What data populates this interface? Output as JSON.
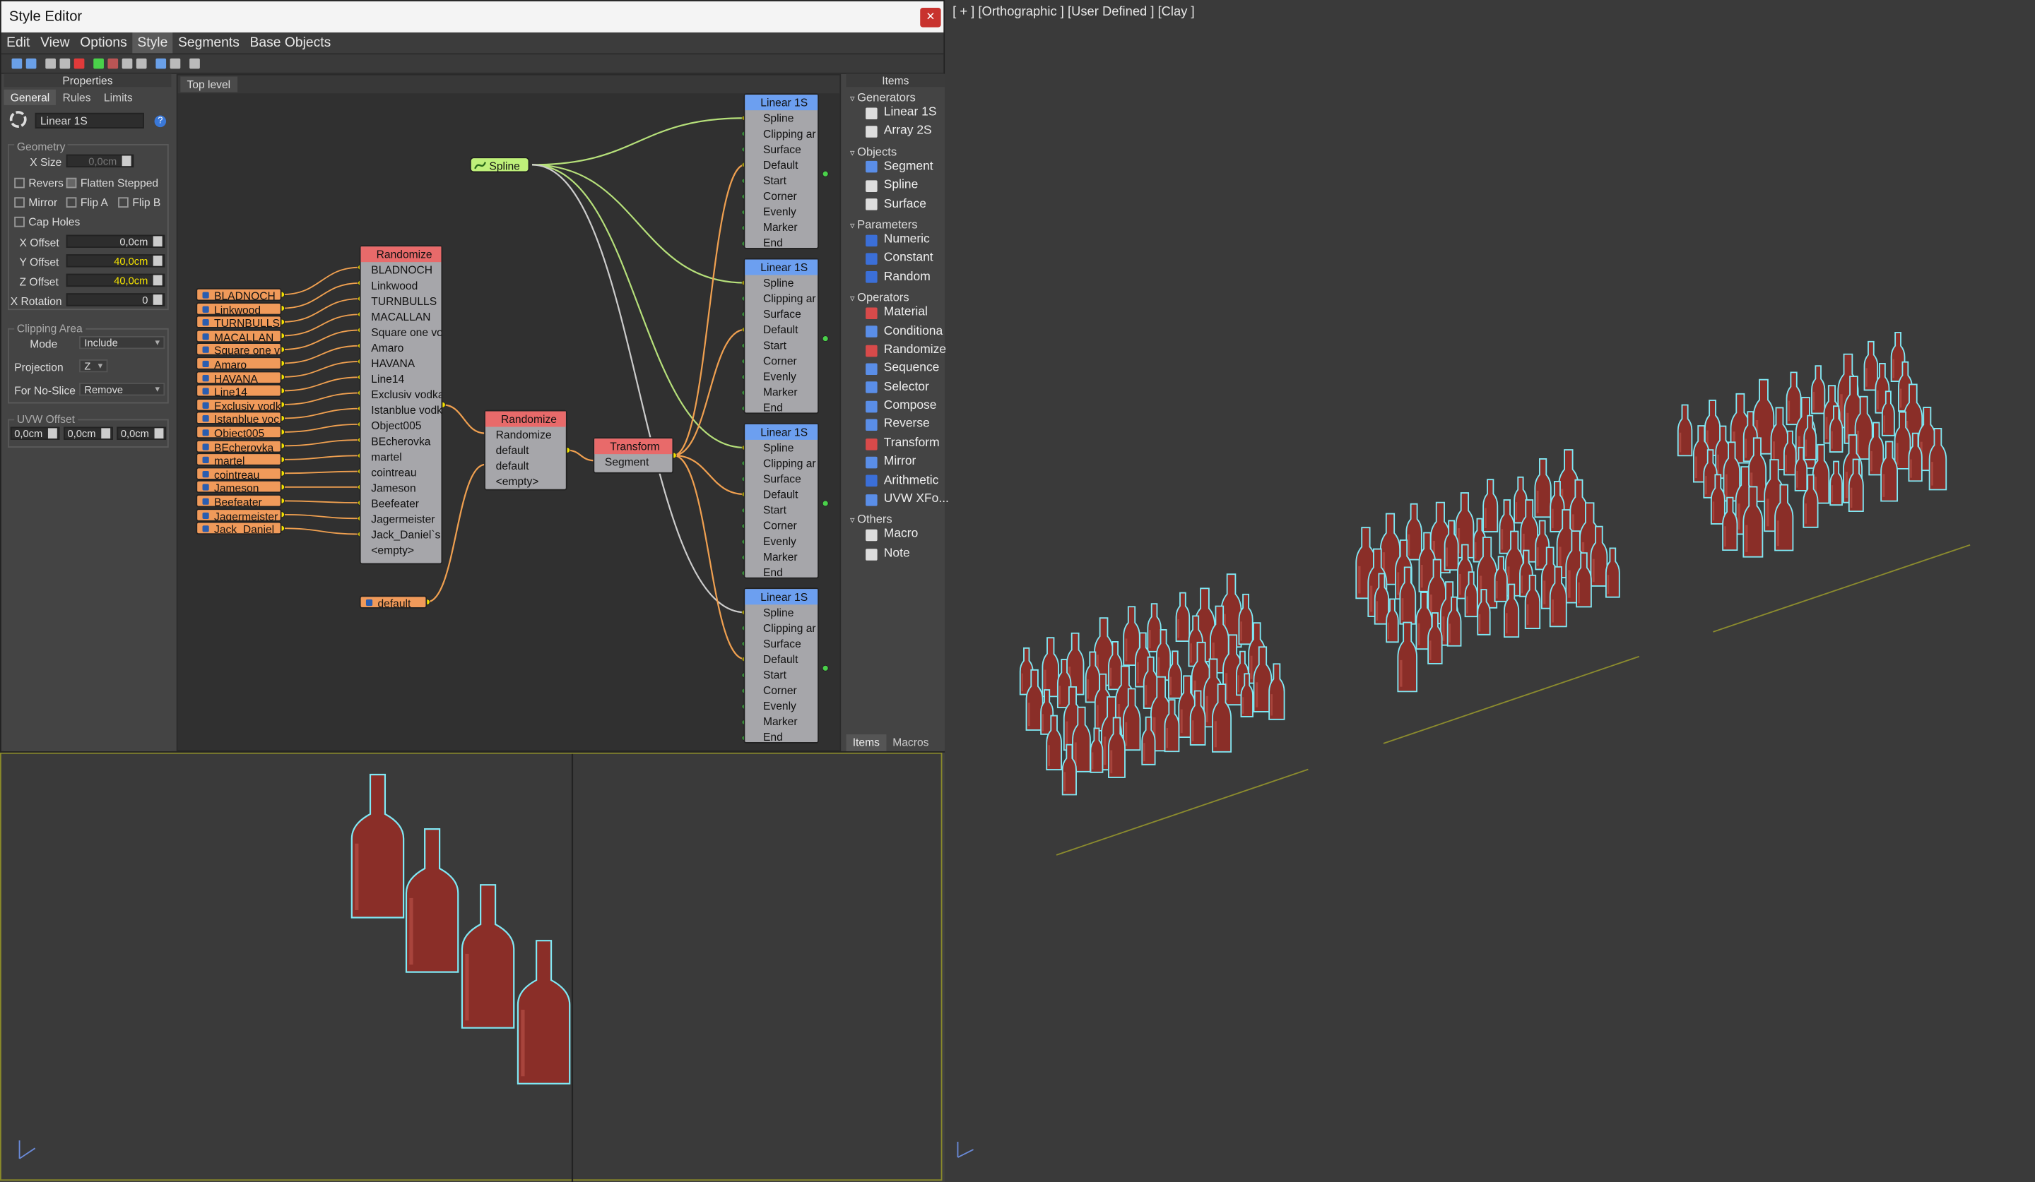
{
  "window": {
    "title": "Style Editor",
    "close_glyph": "×"
  },
  "menu": [
    "Edit",
    "View",
    "Options",
    "Style",
    "Segments",
    "Base Objects"
  ],
  "properties": {
    "header": "Properties",
    "tabs": [
      "General",
      "Rules",
      "Limits"
    ],
    "name": "Linear 1S",
    "help_glyph": "?",
    "geometry_label": "Geometry",
    "x_size_label": "X Size",
    "x_size_value": "0,0cm",
    "reverse_label": "Revers",
    "flatten_label": "Flatten Stepped",
    "mirror_label": "Mirror",
    "flip_a_label": "Flip A",
    "flip_b_label": "Flip B",
    "cap_holes_label": "Cap Holes",
    "x_offset_label": "X Offset",
    "x_offset_value": "0,0cm",
    "y_offset_label": "Y Offset",
    "y_offset_value": "40,0cm",
    "z_offset_label": "Z Offset",
    "z_offset_value": "40,0cm",
    "rotation_label": "X Rotation",
    "rotation_value": "0",
    "clipping_label": "Clipping Area",
    "mode_label": "Mode",
    "mode_value": "Include",
    "projection_label": "Projection",
    "projection_value": "Z",
    "noslice_label": "For No-Slice",
    "noslice_value": "Remove",
    "uvw_label": "UVW Offset",
    "uvw_values": [
      "0,0cm",
      "0,0cm",
      "0,0cm"
    ]
  },
  "graph": {
    "tab": "Top level",
    "spline_label": "Spline",
    "default_label": "default",
    "chips": [
      "BLADNOCH",
      "Linkwood",
      "TURNBULLS",
      "MACALLAN",
      "Square one v",
      "Amaro",
      "HAVANA",
      "Line14",
      "Exclusiv vodk",
      "Istanblue voc",
      "Object005",
      "BEcherovka",
      "martel",
      "cointreau",
      "Jameson",
      "Beefeater",
      "Jagermeister",
      "Jack_Daniel"
    ],
    "randomize1": {
      "title": "Randomize",
      "ports": [
        "BLADNOCH",
        "Linkwood",
        "TURNBULLS",
        "MACALLAN",
        "Square one vo",
        "Amaro",
        "HAVANA",
        "Line14",
        "Exclusiv vodka",
        "Istanblue vodk",
        "Object005",
        "BEcherovka",
        "martel",
        "cointreau",
        "Jameson",
        "Beefeater",
        "Jagermeister",
        "Jack_Daniel`s",
        "<empty>"
      ]
    },
    "randomize2": {
      "title": "Randomize",
      "ports": [
        "Randomize",
        "default",
        "default",
        "<empty>"
      ]
    },
    "transform": {
      "title": "Transform",
      "ports": [
        "Segment"
      ]
    },
    "linear": {
      "title": "Linear 1S",
      "ports": [
        "Spline",
        "Clipping ar",
        "Surface",
        "Default",
        "Start",
        "Corner",
        "Evenly",
        "Marker",
        "End"
      ]
    }
  },
  "items": {
    "header": "Items",
    "groups": [
      {
        "name": "Generators",
        "items": [
          "Linear 1S",
          "Array 2S"
        ]
      },
      {
        "name": "Objects",
        "items": [
          "Segment",
          "Spline",
          "Surface"
        ]
      },
      {
        "name": "Parameters",
        "items": [
          "Numeric",
          "Constant",
          "Random"
        ]
      },
      {
        "name": "Operators",
        "items": [
          "Material",
          "Conditiona",
          "Randomize",
          "Sequence",
          "Selector",
          "Compose",
          "Reverse",
          "Transform",
          "Mirror",
          "Arithmetic",
          "UVW XFo..."
        ]
      },
      {
        "name": "Others",
        "items": [
          "Macro",
          "Note"
        ]
      }
    ],
    "tabs": [
      "Items",
      "Macros"
    ]
  },
  "viewport_right": {
    "label": "[ + ] [Orthographic ] [User Defined ] [Clay ]"
  },
  "colors": {
    "bottle": "#8a2e28",
    "outline": "#7fe8f4",
    "spline_link": "#b6e07a",
    "orange_link": "#f0a050",
    "node_blue": "#6c9ff0",
    "node_red": "#e86a6a",
    "node_green": "#bff07a"
  }
}
